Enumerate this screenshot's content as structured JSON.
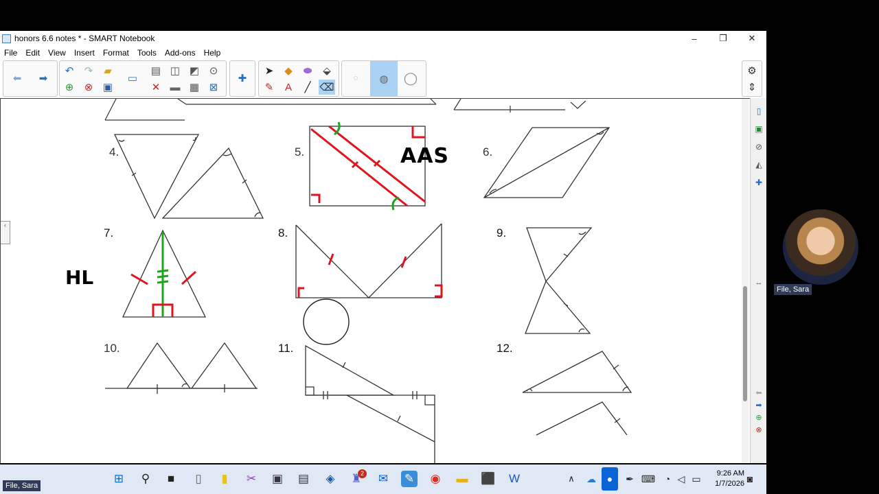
{
  "window": {
    "title": "honors 6.6 notes * - SMART Notebook",
    "minimize": "–",
    "restore": "❐",
    "close": "✕"
  },
  "menu": [
    "File",
    "Edit",
    "View",
    "Insert",
    "Format",
    "Tools",
    "Add-ons",
    "Help"
  ],
  "problems": {
    "p4": "4.",
    "p5": "5.",
    "p6": "6.",
    "p7": "7.",
    "p8": "8.",
    "p9": "9.",
    "p10": "10.",
    "p11": "11.",
    "p12": "12."
  },
  "annotations": {
    "aas": "AAS",
    "hl": "HL"
  },
  "colors": {
    "red_ink": "#e0141e",
    "green_ink": "#1ea51e",
    "highlight_tab": "#a9d2f5"
  },
  "participant": {
    "name": "File, Sara",
    "name_bottom": "File, Sara"
  },
  "taskbar": {
    "time": "9:26 AM",
    "date": "1/7/2026",
    "teams_badge": "2"
  },
  "icons": [
    "windows-start-icon",
    "search-icon",
    "file-explorer-icon",
    "notepad-icon",
    "highlighter-icon",
    "snipping-tool-icon",
    "monitor-icon",
    "remote-desktop-icon",
    "screenshot-icon",
    "teams-icon",
    "outlook-icon",
    "smart-notebook-icon",
    "chrome-icon",
    "folder-icon",
    "pdf-icon",
    "word-icon",
    "chevron-up-icon",
    "onedrive-icon",
    "microphone-icon",
    "pen-icon",
    "keyboard-icon",
    "wifi-icon",
    "volume-icon",
    "battery-icon",
    "notification-icon"
  ]
}
